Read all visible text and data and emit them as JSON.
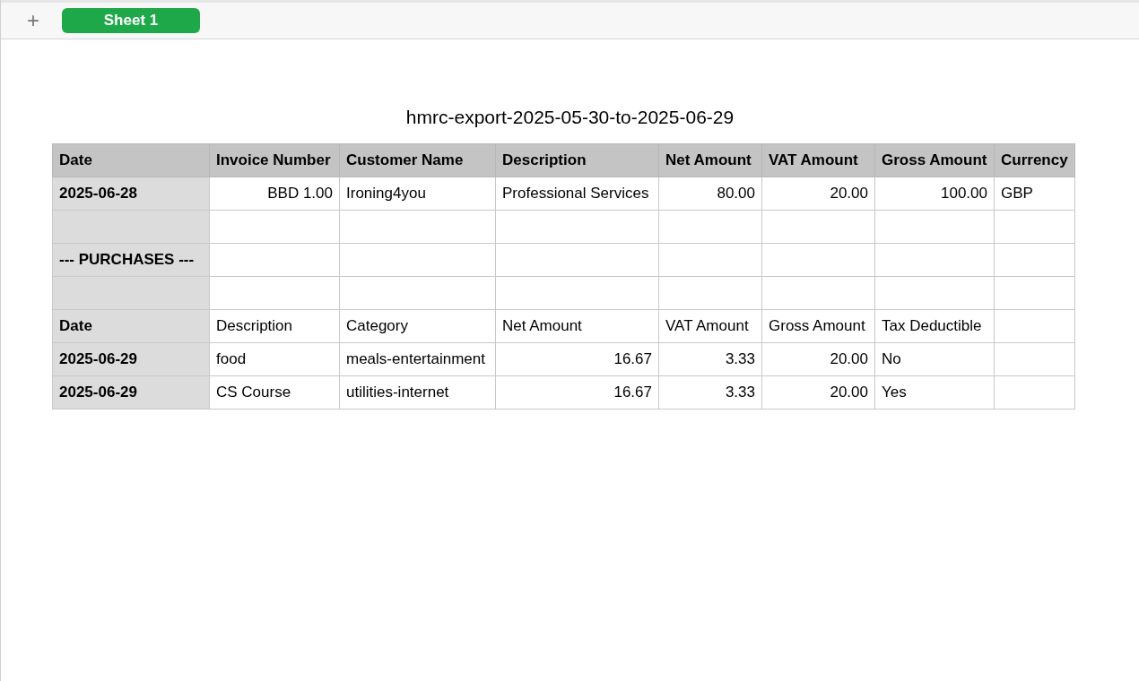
{
  "toolbar": {
    "add_label": "+"
  },
  "tabs": [
    {
      "label": "Sheet 1",
      "selected": true
    }
  ],
  "title": "hmrc-export-2025-05-30-to-2025-06-29",
  "table": {
    "columns": [
      "Date",
      "Invoice Number",
      "Customer Name",
      "Description",
      "Net Amount",
      "VAT Amount",
      "Gross Amount",
      "Currency"
    ],
    "rows": [
      {
        "kind": "data",
        "cells": [
          "2025-06-28",
          {
            "text": "BBD 1.00",
            "kind": "number"
          },
          "Ironing4you",
          "Professional Services",
          {
            "text": "80.00",
            "kind": "number"
          },
          {
            "text": "20.00",
            "kind": "number"
          },
          {
            "text": "100.00",
            "kind": "number"
          },
          "GBP"
        ]
      },
      {
        "kind": "blank",
        "cells": []
      },
      {
        "kind": "section",
        "cells": [
          "--- PURCHASES ---"
        ]
      },
      {
        "kind": "blank",
        "cells": []
      },
      {
        "kind": "data",
        "cells": [
          "Date",
          "Description",
          "Category",
          "Net Amount",
          "VAT Amount",
          "Gross Amount",
          "Tax Deductible"
        ]
      },
      {
        "kind": "data",
        "cells": [
          "2025-06-29",
          "food",
          "meals-entertainment",
          {
            "text": "16.67",
            "kind": "number"
          },
          {
            "text": "3.33",
            "kind": "number"
          },
          {
            "text": "20.00",
            "kind": "number"
          },
          "No"
        ]
      },
      {
        "kind": "data",
        "cells": [
          "2025-06-29",
          "CS Course",
          "utilities-internet",
          {
            "text": "16.67",
            "kind": "number"
          },
          {
            "text": "3.33",
            "kind": "number"
          },
          {
            "text": "20.00",
            "kind": "number"
          },
          "Yes"
        ]
      }
    ]
  }
}
